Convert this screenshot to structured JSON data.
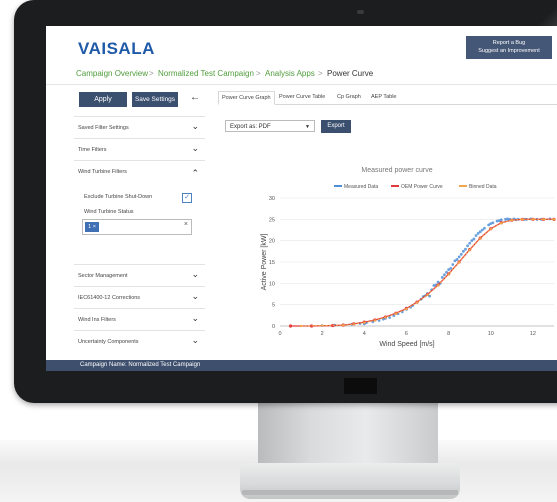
{
  "app": {
    "brand": "VAISALA",
    "report_bug": "Report a Bug",
    "suggest_improvement": "Suggest an Improvement"
  },
  "breadcrumb": [
    "Campaign Overview",
    "Normalized Test Campaign",
    "Analysis Apps",
    "Power Curve"
  ],
  "breadcrumb_separator": ">",
  "sidebar": {
    "apply": "Apply",
    "save_settings": "Save Settings",
    "back_icon": "arrow-left-icon",
    "sections": [
      {
        "label": "Saved Filter Settings",
        "state": "collapsed"
      },
      {
        "label": "Time Filters",
        "state": "collapsed"
      },
      {
        "label": "Wind Turbine Filters",
        "state": "expanded"
      },
      {
        "label": "Sector Management",
        "state": "collapsed"
      },
      {
        "label": "IEC61400-12 Corrections",
        "state": "collapsed"
      },
      {
        "label": "Wind Ins Filters",
        "state": "collapsed"
      },
      {
        "label": "Uncertainty Components",
        "state": "collapsed"
      }
    ],
    "exclude_label": "Exclude Turbine Shut-Down",
    "exclude_checked": true,
    "status_label": "Wind Turbine Status",
    "status_tag": "1",
    "status_tag_remove": "×",
    "status_clear": "×"
  },
  "tabs": [
    {
      "label": "Power Curve Graph",
      "active": true
    },
    {
      "label": "Power Curve Table",
      "active": false
    },
    {
      "label": "Cp Graph",
      "active": false
    },
    {
      "label": "AEP Table",
      "active": false
    }
  ],
  "export": {
    "selected": "Export as: PDF",
    "button": "Export"
  },
  "footer": {
    "campaign_name": "Campaign Name: Normalized Test Campaign"
  },
  "colors": {
    "brand": "#1f5aa8",
    "accent": "#3b4f6f",
    "breadcrumb_link": "#4f9c3c",
    "measured": "#4f8fd8",
    "oem": "#e23b3b",
    "binned": "#f0a64a"
  },
  "chart_data": {
    "type": "scatter",
    "title": "Measured power curve",
    "xlabel": "Wind Speed [m/s]",
    "ylabel": "Active Power [kW]",
    "xlim": [
      0,
      13
    ],
    "ylim": [
      0,
      30
    ],
    "xticks": [
      0,
      2,
      4,
      6,
      8,
      10,
      12
    ],
    "yticks": [
      0,
      5,
      10,
      15,
      20,
      25,
      30
    ],
    "grid": true,
    "legend": "top-center",
    "series": [
      {
        "name": "Measured Data",
        "kind": "scatter",
        "x": [
          2.0,
          2.6,
          3.0,
          3.4,
          3.8,
          4.1,
          4.4,
          4.7,
          4.9,
          5.2,
          5.4,
          5.6,
          5.8,
          6.0,
          6.2,
          6.3,
          6.5,
          6.7,
          6.9,
          7.0,
          7.2,
          7.4,
          7.5,
          7.7,
          7.9,
          8.0,
          8.2,
          8.4,
          8.6,
          8.7,
          8.9,
          9.1,
          9.3,
          9.5,
          9.7,
          9.9,
          10.1,
          10.3,
          10.5,
          10.7,
          10.9,
          11.1,
          11.3,
          11.6,
          11.9,
          12.2,
          12.5,
          12.8,
          4.0,
          5.0,
          6.0,
          6.8,
          7.3,
          7.8,
          8.3,
          8.8,
          9.2,
          9.6,
          10.0,
          10.4,
          10.8,
          11.2,
          11.7,
          12.4,
          7.1,
          7.6,
          8.1,
          8.5,
          9.0,
          9.4
        ],
        "y": [
          0.1,
          0.2,
          0.3,
          0.4,
          0.6,
          0.8,
          1.0,
          1.3,
          1.6,
          2.0,
          2.4,
          2.9,
          3.3,
          3.9,
          4.4,
          4.8,
          5.5,
          6.3,
          7.1,
          7.6,
          8.5,
          9.6,
          10.3,
          11.4,
          12.6,
          13.2,
          14.4,
          15.6,
          16.8,
          17.5,
          18.8,
          20.0,
          21.2,
          22.1,
          22.9,
          23.7,
          24.2,
          24.6,
          24.9,
          25.0,
          25.0,
          25.1,
          25.0,
          25.0,
          25.1,
          25.0,
          25.0,
          25.1,
          0.5,
          1.8,
          4.2,
          6.9,
          9.5,
          12.0,
          15.3,
          18.0,
          20.4,
          22.5,
          24.0,
          24.7,
          25.1,
          24.9,
          25.0,
          25.0,
          7.0,
          10.0,
          13.5,
          16.2,
          19.4,
          21.7
        ]
      },
      {
        "name": "OEM Power Curve",
        "kind": "line",
        "x": [
          0.5,
          1.5,
          2.5,
          3.0,
          3.5,
          4.0,
          4.5,
          5.0,
          5.5,
          6.0,
          6.5,
          7.0,
          7.5,
          8.0,
          8.5,
          9.0,
          9.5,
          10.0,
          10.5,
          11.0,
          11.5,
          12.0,
          12.5,
          13.0
        ],
        "y": [
          0,
          0,
          0.1,
          0.2,
          0.5,
          0.9,
          1.4,
          2.1,
          3.0,
          4.1,
          5.6,
          7.4,
          9.6,
          12.2,
          15.0,
          17.9,
          20.6,
          22.8,
          24.2,
          24.8,
          25.0,
          25.0,
          25.0,
          25.0
        ]
      },
      {
        "name": "Binned Data",
        "kind": "line",
        "x": [
          1.0,
          2.0,
          3.0,
          3.5,
          4.0,
          4.5,
          5.0,
          5.5,
          6.0,
          6.5,
          7.0,
          7.5,
          8.0,
          8.5,
          9.0,
          9.5,
          10.0,
          10.5,
          11.0,
          11.5,
          12.0,
          12.5,
          13.0
        ],
        "y": [
          0,
          0.1,
          0.2,
          0.4,
          0.8,
          1.3,
          2.0,
          2.9,
          4.0,
          5.5,
          7.3,
          9.5,
          12.1,
          14.9,
          17.8,
          20.5,
          22.7,
          24.1,
          24.8,
          25.0,
          25.0,
          25.0,
          25.0
        ]
      }
    ]
  }
}
